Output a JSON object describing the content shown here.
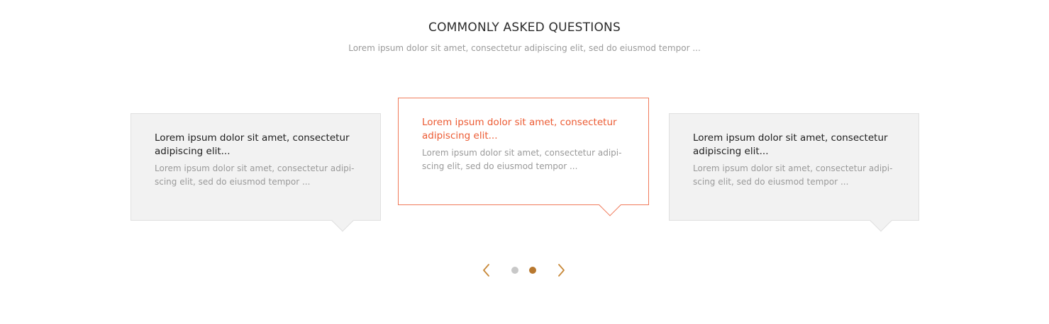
{
  "header": {
    "title": "COMMONLY ASKED QUESTIONS",
    "subtitle": "Lorem ipsum dolor sit amet, consectetur adipiscing elit, sed do eiusmod tempor ..."
  },
  "cards": [
    {
      "question": "Lorem ipsum dolor sit amet, consectetur adipiscing elit...",
      "answer": "Lorem ipsum dolor sit amet, consectetur adipi-scing elit, sed do eiusmod tempor ...",
      "active": false
    },
    {
      "question": "Lorem ipsum dolor sit amet, consectetur adipiscing elit...",
      "answer": "Lorem ipsum dolor sit amet, consectetur adipi-scing elit, sed do eiusmod tempor ...",
      "active": true
    },
    {
      "question": "Lorem ipsum dolor sit amet, consectetur adipiscing elit...",
      "answer": "Lorem ipsum dolor sit amet, consectetur adipi-scing elit, sed do eiusmod tempor ...",
      "active": false
    }
  ],
  "pagination": {
    "page_count": 2,
    "active_page": 2,
    "prev_icon": "chevron-left-icon",
    "next_icon": "chevron-right-icon"
  },
  "colors": {
    "accent": "#ec5a32",
    "nav_accent": "#c8893a",
    "dot_inactive": "#c8c8c8",
    "dot_active": "#b8782f",
    "card_bg": "#f2f2f2"
  }
}
